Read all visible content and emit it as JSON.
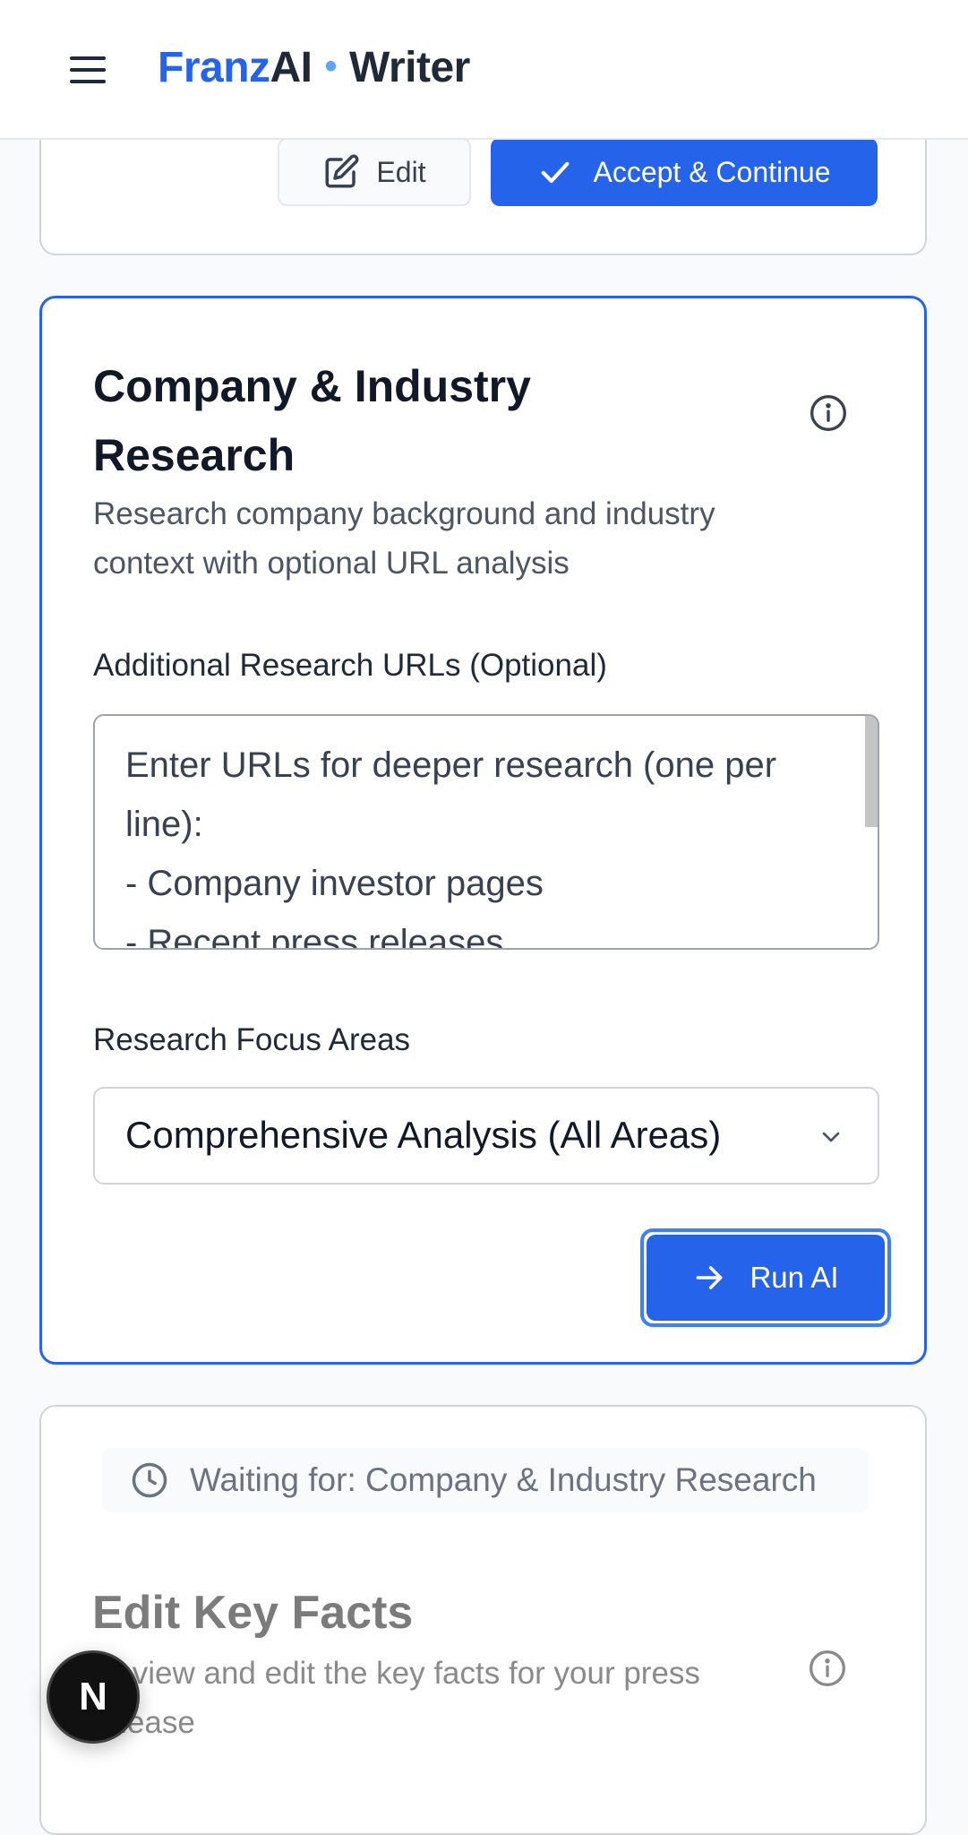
{
  "header": {
    "brand_franz": "Franz",
    "brand_ai": "AI",
    "brand_dot": "•",
    "brand_writer": "Writer"
  },
  "top_card": {
    "edit_label": "Edit",
    "accept_label": "Accept & Continue"
  },
  "research_card": {
    "title": "Company & Industry Research",
    "description": "Research company background and industry context with optional URL analysis",
    "urls_label": "Additional Research URLs (Optional)",
    "urls_placeholder": "Enter URLs for deeper research (one per line):\n- Company investor pages\n- Recent press releases",
    "focus_label": "Research Focus Areas",
    "focus_value": "Comprehensive Analysis (All Areas)",
    "run_label": "Run AI"
  },
  "waiting_card": {
    "waiting_text": "Waiting for: Company & Industry Research",
    "title": "Edit Key Facts",
    "description": "Review and edit the key facts for your press release"
  },
  "badge": {
    "letter": "N"
  },
  "colors": {
    "primary": "#2563eb",
    "brand_blue": "#2563eb",
    "dot_blue": "#60a5fa"
  }
}
